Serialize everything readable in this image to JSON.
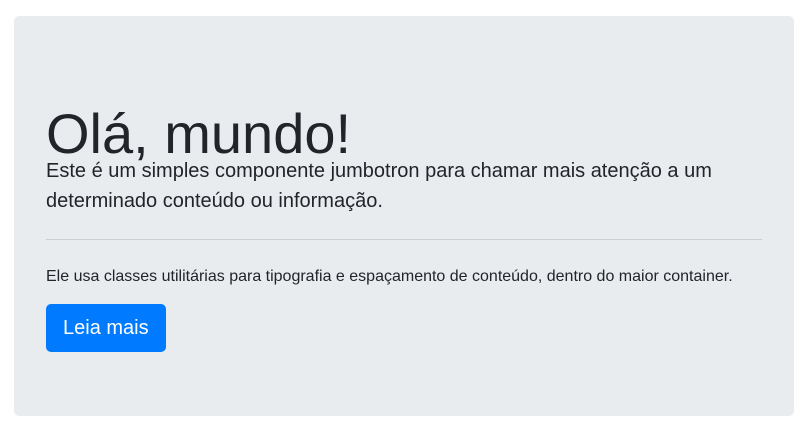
{
  "jumbotron": {
    "title": "Olá, mundo!",
    "lead": "Este é um simples componente jumbotron para chamar mais atenção a um determinado conteúdo ou informação.",
    "body": "Ele usa classes utilitárias para tipografia e espaçamento de conteúdo, dentro do maior container.",
    "button_label": "Leia mais"
  },
  "colors": {
    "background": "#e9ecef",
    "text": "#212529",
    "primary": "#007bff"
  }
}
